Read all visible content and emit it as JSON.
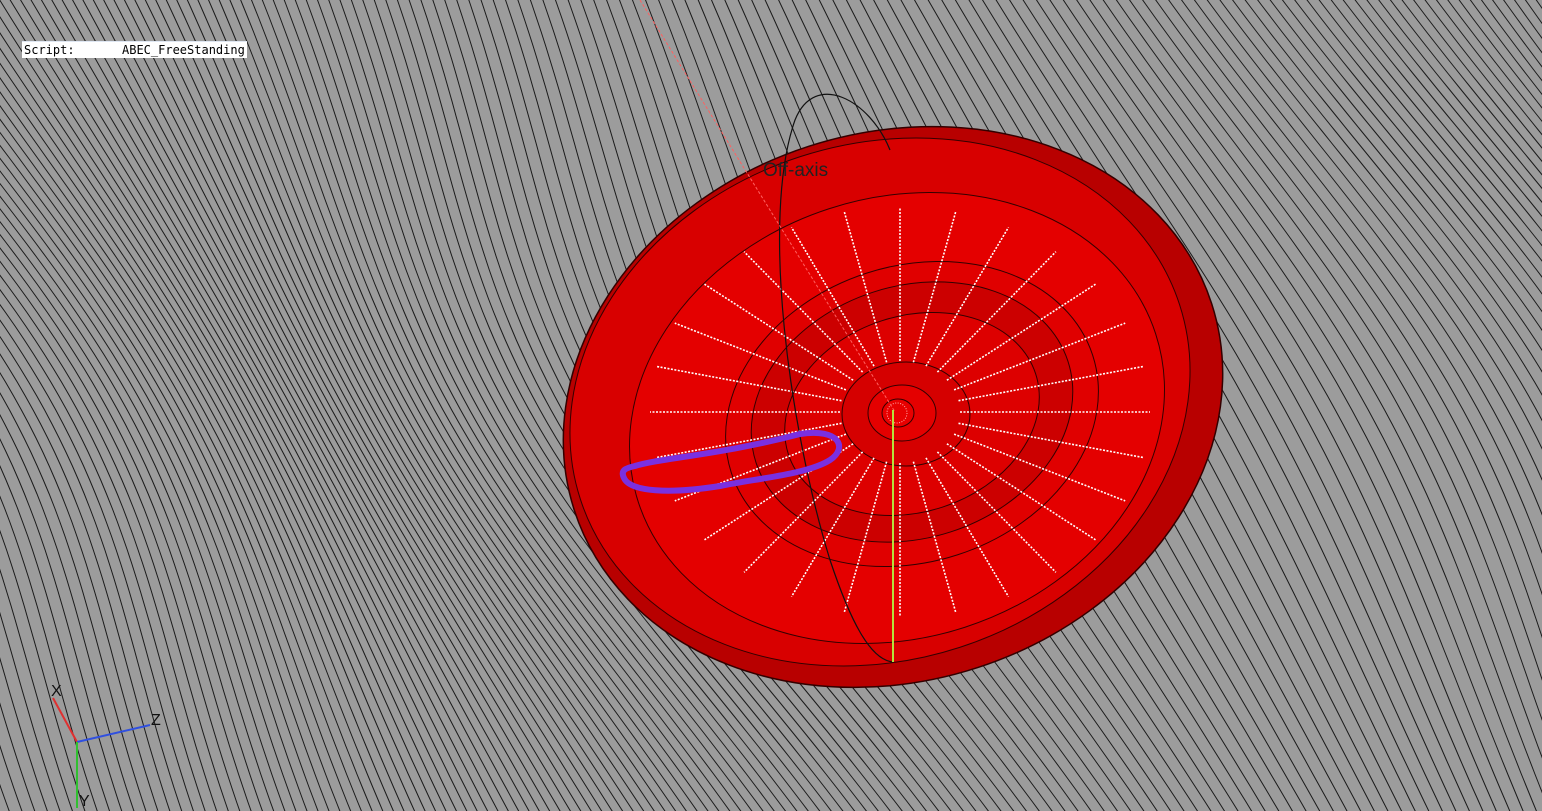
{
  "script": {
    "key": "Script:",
    "value": "ABEC_FreeStanding"
  },
  "viewport": {
    "background": "#9c9c9c",
    "mesh_line_color": "#1a1a1a",
    "driver_color": "#e00000",
    "driver_rim_color": "#b80000",
    "annotation_color": "#7a30e0",
    "offaxis_label": "Off-axis",
    "y_axis_line_color": "#b6e23c",
    "off_axis_line_color": "#ff6060"
  },
  "triad": {
    "x_label": "X",
    "y_label": "Y",
    "z_label": "Z",
    "x_color": "#e03030",
    "y_color": "#30c030",
    "z_color": "#3050e0"
  }
}
